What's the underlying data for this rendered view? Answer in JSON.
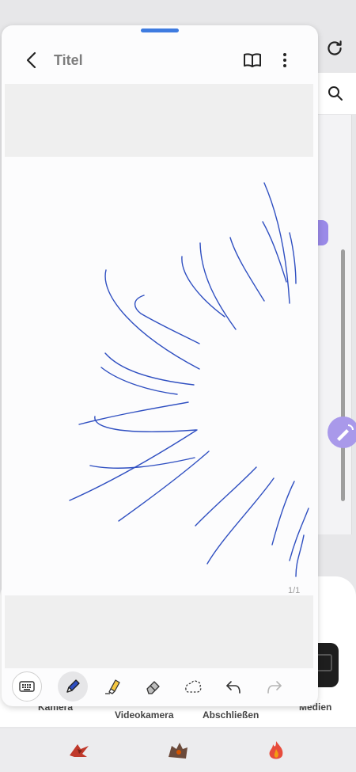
{
  "note": {
    "title": "Titel",
    "page_indicator": "1/1"
  },
  "toolbar": {
    "tools": [
      {
        "name": "keyboard",
        "icon": "keyboard-icon",
        "active": false
      },
      {
        "name": "pen",
        "icon": "pen-icon",
        "active": true
      },
      {
        "name": "highlighter",
        "icon": "highlighter-icon",
        "active": false
      },
      {
        "name": "eraser",
        "icon": "eraser-icon",
        "active": false
      },
      {
        "name": "lasso",
        "icon": "lasso-icon",
        "active": false
      },
      {
        "name": "undo",
        "icon": "undo-icon",
        "active": false
      },
      {
        "name": "redo",
        "icon": "redo-icon",
        "active": false
      }
    ]
  },
  "background_app": {
    "labels": {
      "kamera": "Kamera",
      "videokamera": "Videokamera",
      "abschliessen": "Abschließen",
      "medien": "Medien"
    }
  },
  "colors": {
    "ink": "#2f4fc1",
    "accent": "#3e7be0",
    "highlighter": "#f5c842",
    "fab": "#a999ea"
  }
}
